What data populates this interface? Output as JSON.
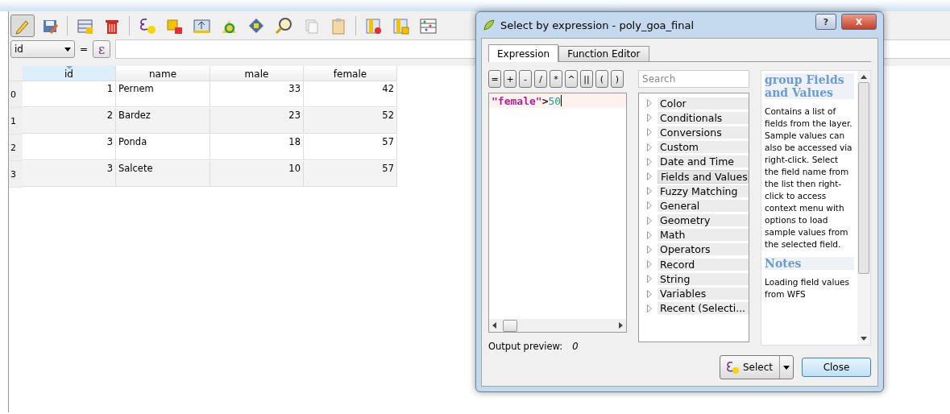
{
  "toolbar": [
    {
      "pressed": true
    },
    {
      "pressed": false
    },
    {
      "pressed": false
    },
    {
      "pressed": false
    },
    {
      "pressed": false
    },
    {
      "pressed": false
    },
    {
      "pressed": false
    },
    {
      "pressed": false
    },
    {
      "pressed": false
    },
    {
      "pressed": false
    },
    {
      "pressed": false
    },
    {
      "pressed": false
    },
    {
      "pressed": false
    },
    {
      "pressed": false
    },
    {
      "pressed": false
    }
  ],
  "filter": {
    "field": "id",
    "equals": "=",
    "expression_button": "ε"
  },
  "table": {
    "columns": [
      {
        "label": "id",
        "sorted": true
      },
      {
        "label": "name",
        "sorted": false
      },
      {
        "label": "male",
        "sorted": false
      },
      {
        "label": "female",
        "sorted": false
      }
    ],
    "rows": [
      {
        "header": "0",
        "cells": [
          "1",
          "Pernem",
          "33",
          "42"
        ]
      },
      {
        "header": "1",
        "cells": [
          "2",
          "Bardez",
          "23",
          "52"
        ]
      },
      {
        "header": "2",
        "cells": [
          "3",
          "Ponda",
          "18",
          "57"
        ]
      },
      {
        "header": "3",
        "cells": [
          "3",
          "Salcete",
          "10",
          "57"
        ]
      }
    ]
  },
  "dialog": {
    "title": "Select by expression - poly_goa_final",
    "help_button": "?",
    "close_button": "X",
    "tabs": [
      {
        "label": "Expression",
        "selected": true
      },
      {
        "label": "Function Editor",
        "selected": false
      }
    ],
    "operators": [
      "=",
      "+",
      "-",
      "/",
      "*",
      "^",
      "||",
      "(",
      ")"
    ],
    "expression": [
      {
        "kind": "field",
        "text": "\"female\""
      },
      {
        "kind": "operator",
        "text": ">"
      },
      {
        "kind": "number",
        "text": "50"
      }
    ],
    "search": {
      "placeholder": "Search"
    },
    "groups": [
      {
        "label": "Color",
        "selected": false
      },
      {
        "label": "Conditionals",
        "selected": false
      },
      {
        "label": "Conversions",
        "selected": false
      },
      {
        "label": "Custom",
        "selected": false
      },
      {
        "label": "Date and Time",
        "selected": false
      },
      {
        "label": "Fields and Values",
        "selected": true
      },
      {
        "label": "Fuzzy Matching",
        "selected": false
      },
      {
        "label": "General",
        "selected": false
      },
      {
        "label": "Geometry",
        "selected": false
      },
      {
        "label": "Math",
        "selected": false
      },
      {
        "label": "Operators",
        "selected": false
      },
      {
        "label": "Record",
        "selected": false
      },
      {
        "label": "String",
        "selected": false
      },
      {
        "label": "Variables",
        "selected": false
      },
      {
        "label": "Recent (Selecti...",
        "selected": false
      }
    ],
    "help": {
      "heading": "group Fields and Values",
      "body": "Contains a list of fields from the layer. Sample values can also be accessed via right-click. Select the field name from the list then right-click to access context menu with options to load sample values from the selected field.",
      "notes_heading": "Notes",
      "notes_body": "Loading field values from WFS"
    },
    "output_preview": {
      "label": "Output preview:",
      "value": "0"
    },
    "select_button": {
      "label": "Select"
    },
    "close": "Close"
  }
}
